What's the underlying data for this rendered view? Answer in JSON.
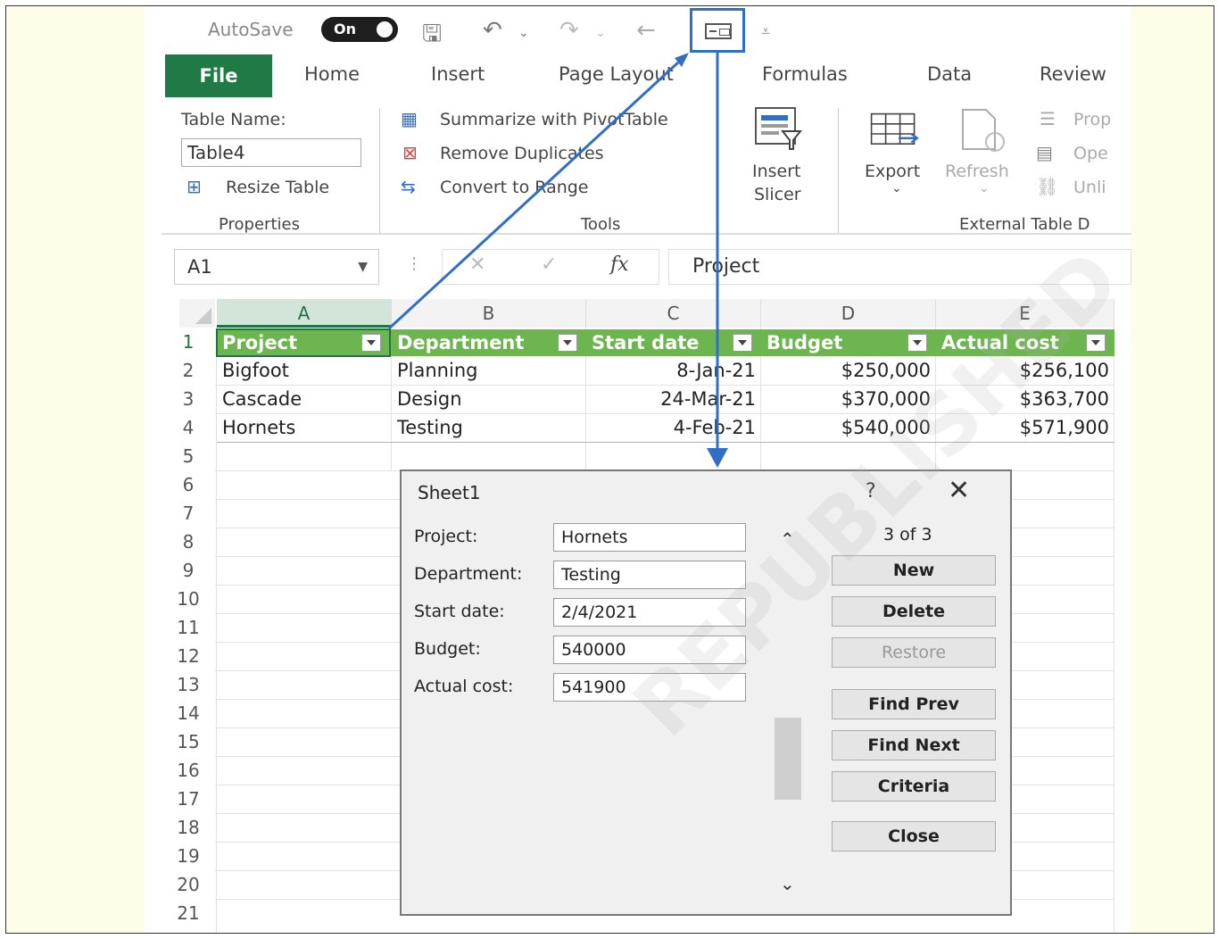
{
  "qat": {
    "autosave_label": "AutoSave",
    "toggle_label": "On"
  },
  "tabs": [
    "File",
    "Home",
    "Insert",
    "Page Layout",
    "Formulas",
    "Data",
    "Review"
  ],
  "ribbon": {
    "properties": {
      "table_name_label": "Table Name:",
      "table_name_value": "Table4",
      "resize_label": "Resize Table",
      "group_label": "Properties"
    },
    "tools": {
      "summarize_label": "Summarize with PivotTable",
      "remove_dup_label": "Remove Duplicates",
      "convert_label": "Convert to Range",
      "group_label": "Tools"
    },
    "slicer": {
      "line1": "Insert",
      "line2": "Slicer"
    },
    "external": {
      "export_label": "Export",
      "refresh_label": "Refresh",
      "prop_label": "Prop",
      "open_label": "Ope",
      "unlink_label": "Unli",
      "group_label": "External Table D"
    }
  },
  "formula_bar": {
    "name_box": "A1",
    "fx": "fx",
    "formula": "Project"
  },
  "grid": {
    "columns": [
      "A",
      "B",
      "C",
      "D",
      "E"
    ],
    "rows": [
      "1",
      "2",
      "3",
      "4",
      "5",
      "6",
      "7",
      "8",
      "9",
      "10",
      "11",
      "12",
      "13",
      "14",
      "15",
      "16",
      "17",
      "18",
      "19",
      "20",
      "21"
    ],
    "headers": [
      "Project",
      "Department",
      "Start date",
      "Budget",
      "Actual cost"
    ],
    "data": [
      [
        "Bigfoot",
        "Planning",
        "8-Jan-21",
        "$250,000",
        "$256,100"
      ],
      [
        "Cascade",
        "Design",
        "24-Mar-21",
        "$370,000",
        "$363,700"
      ],
      [
        "Hornets",
        "Testing",
        "4-Feb-21",
        "$540,000",
        "$571,900"
      ]
    ]
  },
  "dialog": {
    "title": "Sheet1",
    "help": "?",
    "close_symbol": "✕",
    "record_counter": "3 of 3",
    "fields": [
      {
        "label": "Project:",
        "value": "Hornets"
      },
      {
        "label": "Department:",
        "value": "Testing"
      },
      {
        "label": "Start date:",
        "value": "2/4/2021"
      },
      {
        "label": "Budget:",
        "value": "540000"
      },
      {
        "label": "Actual cost:",
        "value": "541900"
      }
    ],
    "buttons": {
      "new": "New",
      "delete": "Delete",
      "restore": "Restore",
      "find_prev": "Find Prev",
      "find_next": "Find Next",
      "criteria": "Criteria",
      "close": "Close"
    }
  },
  "watermark": "REPUBLISHED",
  "colors": {
    "excel_green": "#217346",
    "table_header": "#6db54f",
    "file_tab": "#1f7a45",
    "arrow_blue": "#2f6fc4"
  }
}
